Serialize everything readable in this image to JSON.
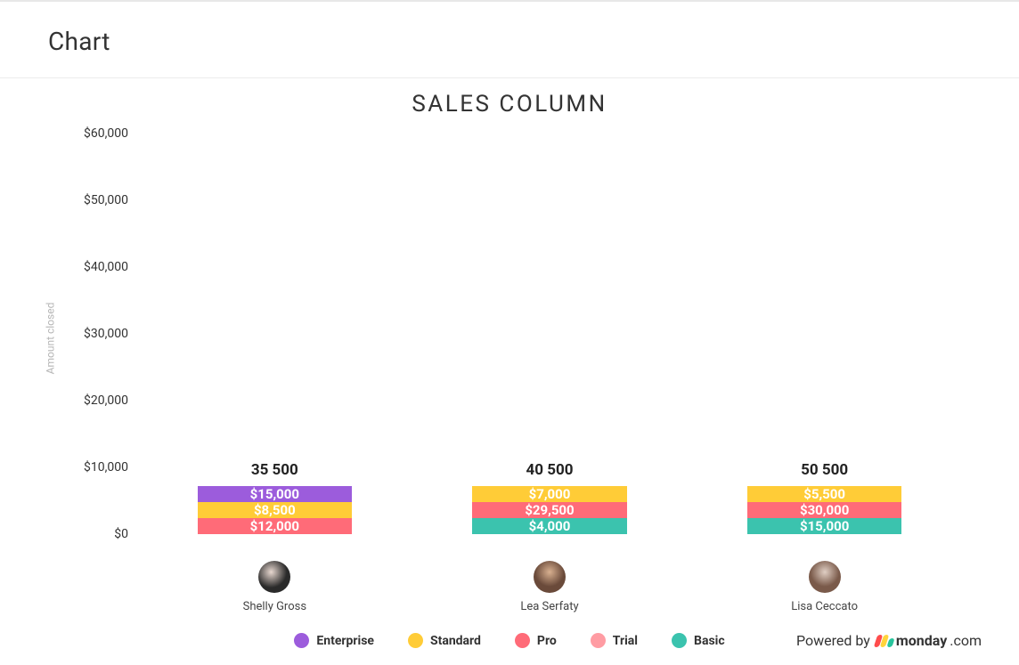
{
  "header": {
    "title": "Chart"
  },
  "chart_title": "SALES COLUMN",
  "y_axis_label": "Amount closed",
  "y_ticks": [
    "$0",
    "$10,000",
    "$20,000",
    "$30,000",
    "$40,000",
    "$50,000",
    "$60,000"
  ],
  "colors": {
    "Enterprise": "#9c5cdc",
    "Standard": "#ffcc37",
    "Pro": "#ff6b78",
    "Trial": "#ff9ca3",
    "Basic": "#3bc3ae"
  },
  "legend": [
    {
      "name": "Enterprise",
      "color_key": "Enterprise"
    },
    {
      "name": "Standard",
      "color_key": "Standard"
    },
    {
      "name": "Pro",
      "color_key": "Pro"
    },
    {
      "name": "Trial",
      "color_key": "Trial"
    },
    {
      "name": "Basic",
      "color_key": "Basic"
    }
  ],
  "bars": [
    {
      "name": "Shelly Gross",
      "total_label": "35 500",
      "segments": [
        {
          "series": "Pro",
          "value": 12000,
          "label": "$12,000"
        },
        {
          "series": "Standard",
          "value": 8500,
          "label": "$8,500"
        },
        {
          "series": "Enterprise",
          "value": 15000,
          "label": "$15,000"
        }
      ]
    },
    {
      "name": "Lea Serfaty",
      "total_label": "40 500",
      "segments": [
        {
          "series": "Basic",
          "value": 4000,
          "label": "$4,000"
        },
        {
          "series": "Pro",
          "value": 29500,
          "label": "$29,500"
        },
        {
          "series": "Standard",
          "value": 7000,
          "label": "$7,000"
        }
      ]
    },
    {
      "name": "Lisa Ceccato",
      "total_label": "50 500",
      "segments": [
        {
          "series": "Basic",
          "value": 15000,
          "label": "$15,000"
        },
        {
          "series": "Pro",
          "value": 30000,
          "label": "$30,000"
        },
        {
          "series": "Standard",
          "value": 5500,
          "label": "$5,500"
        }
      ]
    }
  ],
  "powered_by": {
    "prefix": "Powered by",
    "brand": "monday",
    "suffix": ".com"
  },
  "chart_data": {
    "type": "bar",
    "stacked": true,
    "title": "SALES COLUMN",
    "xlabel": "",
    "ylabel": "Amount closed",
    "ylim": [
      0,
      60000
    ],
    "y_ticks": [
      0,
      10000,
      20000,
      30000,
      40000,
      50000,
      60000
    ],
    "categories": [
      "Shelly Gross",
      "Lea Serfaty",
      "Lisa Ceccato"
    ],
    "series": [
      {
        "name": "Enterprise",
        "values": [
          15000,
          0,
          0
        ]
      },
      {
        "name": "Standard",
        "values": [
          8500,
          7000,
          5500
        ]
      },
      {
        "name": "Pro",
        "values": [
          12000,
          29500,
          30000
        ]
      },
      {
        "name": "Trial",
        "values": [
          0,
          0,
          0
        ]
      },
      {
        "name": "Basic",
        "values": [
          0,
          4000,
          15000
        ]
      }
    ],
    "totals": [
      35500,
      40500,
      50500
    ]
  }
}
